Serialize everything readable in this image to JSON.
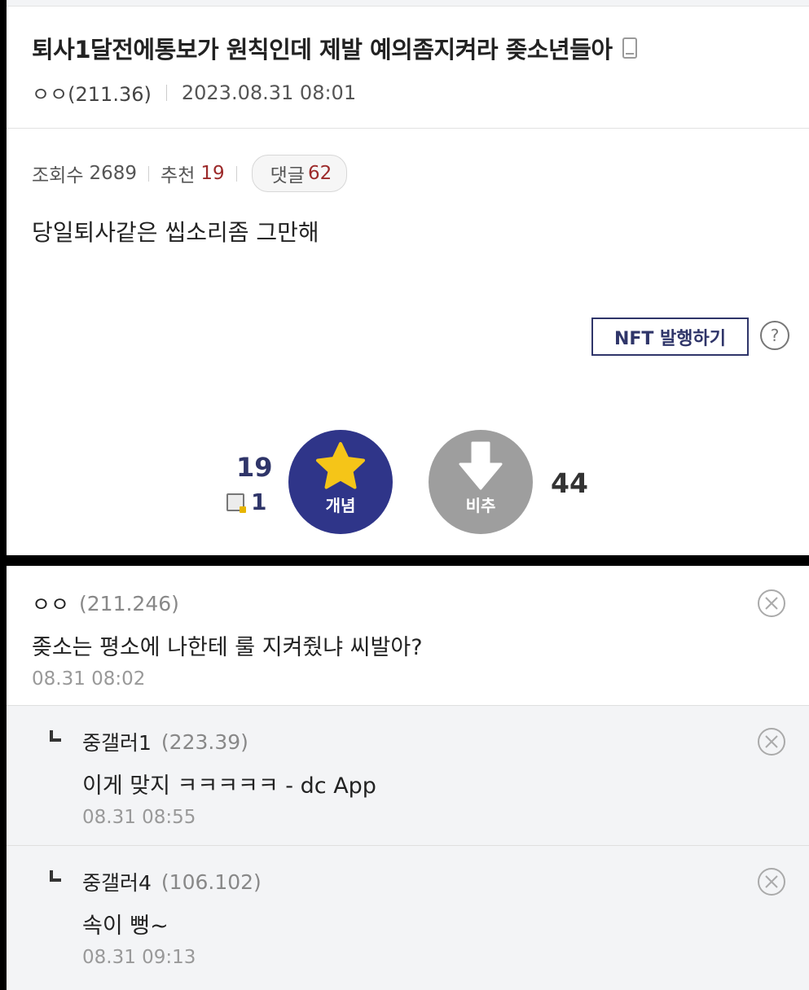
{
  "post": {
    "title": "퇴사1달전에통보가 원칙인데 제발 예의좀지켜라 좆소년들아",
    "author": "ㅇㅇ(211.36)",
    "date": "2023.08.31 08:01",
    "views_label": "조회수",
    "views": "2689",
    "recommend_label": "추천",
    "recommend": "19",
    "comments_label": "댓글",
    "comments": "62",
    "body": "당일퇴사같은 씹소리좀 그만해",
    "nft_button": "NFT 발행하기",
    "help": "?"
  },
  "votes": {
    "up_count": "19",
    "fix_count": "1",
    "up_label": "개념",
    "down_label": "비추",
    "down_count": "44",
    "up_color": "#2f3589",
    "down_color": "#9e9e9e",
    "star_color": "#f5c518"
  },
  "comments": [
    {
      "author": "ㅇㅇ",
      "ip": "(211.246)",
      "text": "좆소는 평소에 나한테 룰 지켜줬냐 씨발아?",
      "date": "08.31 08:02",
      "reply": false
    },
    {
      "author": "중갤러1",
      "ip": "(223.39)",
      "text": "이게 맞지 ㅋㅋㅋㅋㅋ - dc App",
      "date": "08.31 08:55",
      "reply": true
    },
    {
      "author": "중갤러4",
      "ip": "(106.102)",
      "text": "속이 뻥~",
      "date": "08.31 09:13",
      "reply": true
    }
  ]
}
